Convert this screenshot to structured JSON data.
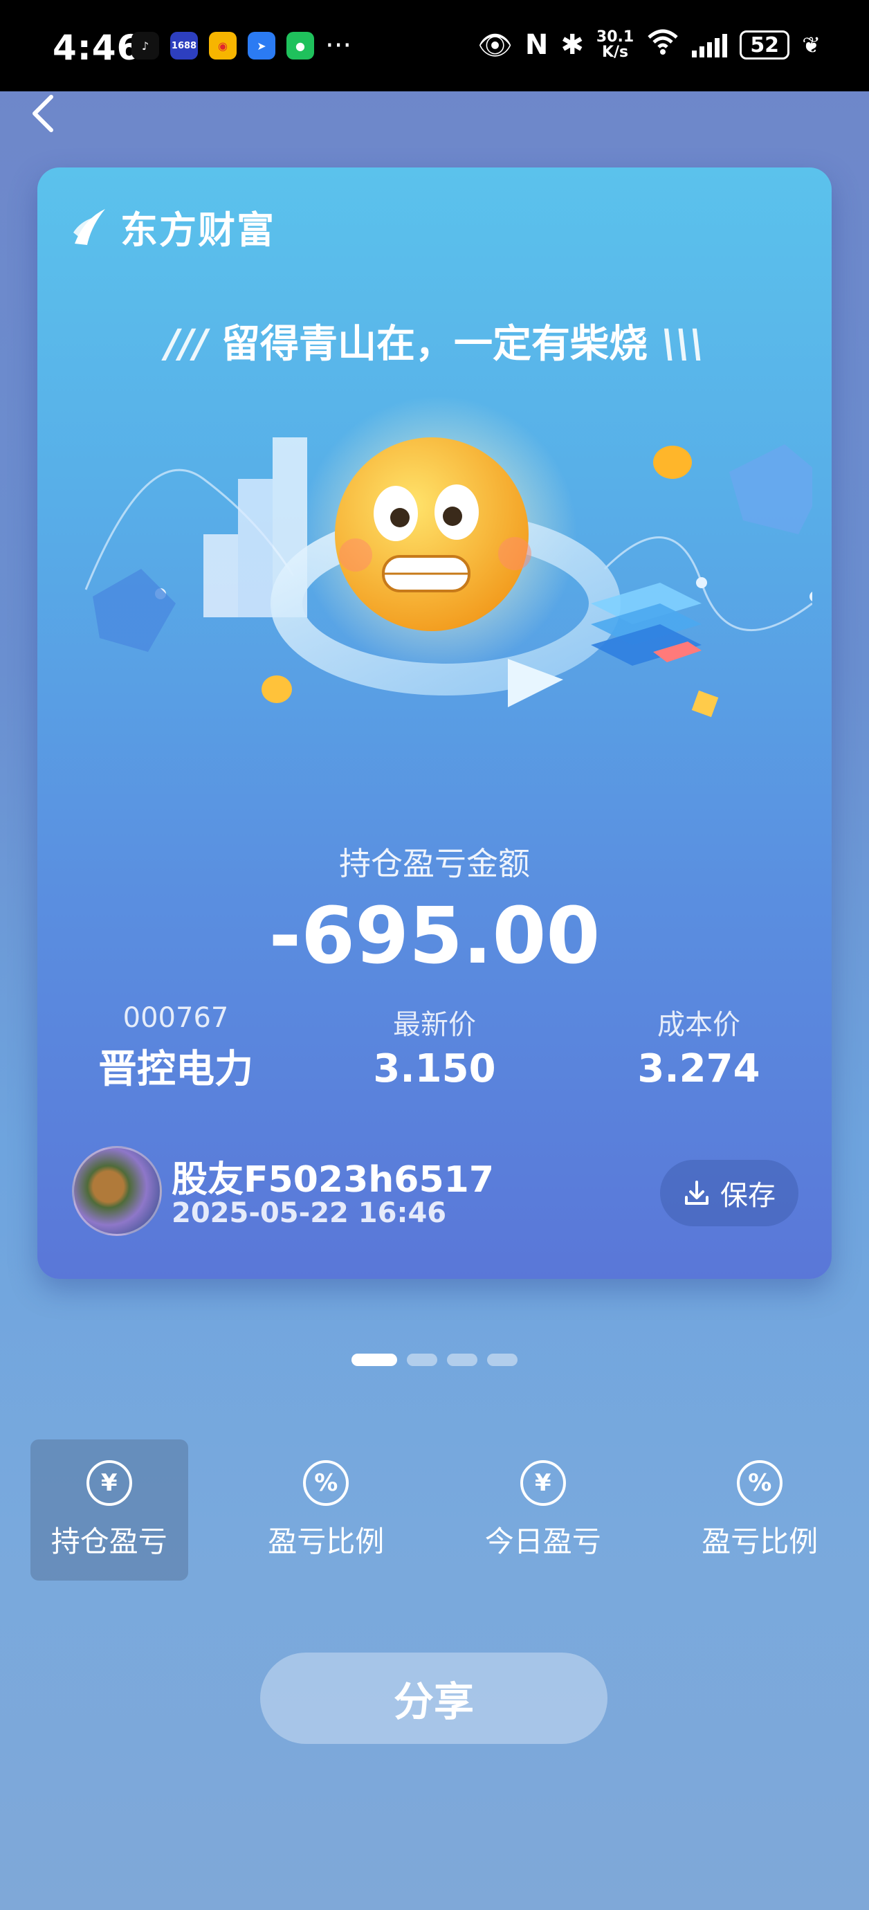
{
  "status_bar": {
    "time": "4:46",
    "apps": [
      "tiktok-icon",
      "1688-icon",
      "weibo-icon",
      "feishu-icon",
      "wechat-icon"
    ],
    "app_1688_label": "1688",
    "more": "···",
    "net_speed_value": "30.1",
    "net_speed_unit": "K/s",
    "battery": "52"
  },
  "card": {
    "brand_name": "东方财富",
    "slogan": "留得青山在，一定有柴烧",
    "pnl_label": "持仓盈亏金额",
    "pnl_value": "-695.00",
    "stock_code": "000767",
    "stock_name": "晋控电力",
    "latest_price_label": "最新价",
    "latest_price": "3.150",
    "cost_price_label": "成本价",
    "cost_price": "3.274",
    "user_name": "股友F5023h6517",
    "timestamp": "2025-05-22 16:46",
    "save_label": "保存"
  },
  "pager": {
    "count": 4,
    "active_index": 0
  },
  "options": [
    {
      "icon": "yen-icon",
      "symbol": "¥",
      "label": "持仓盈亏",
      "selected": true
    },
    {
      "icon": "percent-icon",
      "symbol": "%",
      "label": "盈亏比例",
      "selected": false
    },
    {
      "icon": "yen-icon",
      "symbol": "¥",
      "label": "今日盈亏",
      "selected": false
    },
    {
      "icon": "percent-icon",
      "symbol": "%",
      "label": "盈亏比例",
      "selected": false
    }
  ],
  "share_label": "分享"
}
